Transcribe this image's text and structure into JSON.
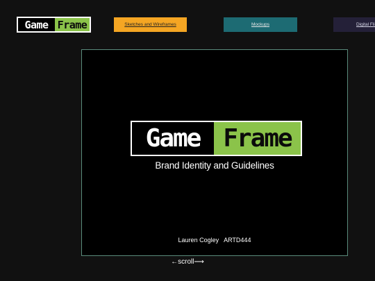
{
  "header": {
    "logo": {
      "word1": "Game",
      "word2": "Frame"
    }
  },
  "nav": {
    "items": [
      {
        "label": "Sketches and Wireframes"
      },
      {
        "label": "Mockups"
      },
      {
        "label": "Digital Flip"
      }
    ]
  },
  "slide": {
    "logo": {
      "word1": "Game",
      "word2": "Frame"
    },
    "subtitle": "Brand Identity and Guidelines",
    "credit": "Lauren Cogley   ARTD444"
  },
  "scroll_hint": "←scroll⟶",
  "colors": {
    "background": "#111111",
    "logo_green": "#8bc34a",
    "nav_sketch": "#f5a623",
    "nav_mockups": "#1d6b73",
    "nav_flip": "#242038",
    "slide_border": "#5a8c7c"
  }
}
